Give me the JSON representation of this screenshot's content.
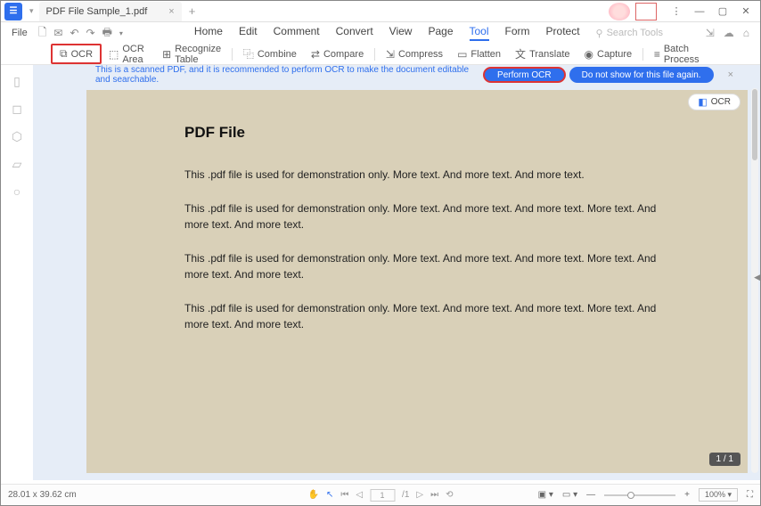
{
  "title_tab": "PDF File Sample_1.pdf",
  "menu_file": "File",
  "main_tabs": {
    "home": "Home",
    "edit": "Edit",
    "comment": "Comment",
    "convert": "Convert",
    "view": "View",
    "page": "Page",
    "tool": "Tool",
    "form": "Form",
    "protect": "Protect"
  },
  "search_placeholder": "Search Tools",
  "tools": {
    "ocr": "OCR",
    "ocr_area": "OCR Area",
    "recognize": "Recognize Table",
    "combine": "Combine",
    "compare": "Compare",
    "compress": "Compress",
    "flatten": "Flatten",
    "translate": "Translate",
    "capture": "Capture",
    "batch": "Batch Process"
  },
  "banner": {
    "msg": "This is a scanned PDF, and it is recommended to perform OCR to make the document editable and searchable.",
    "perform": "Perform OCR",
    "noshow": "Do not show for this file again."
  },
  "doc": {
    "heading": "PDF File",
    "p1": "This .pdf file is used for demonstration only. More text. And more text. And more text.",
    "p2": "This .pdf file is used for demonstration only. More text. And more text. And more text. More text. And more text. And more text.",
    "p3": "This .pdf file is used for demonstration only. More text. And more text. And more text. More text. And more text. And more text.",
    "p4": "This .pdf file is used for demonstration only. More text. And more text. And more text. More text. And more text. And more text."
  },
  "ocr_chip": "OCR",
  "page_counter": "1 / 1",
  "status": {
    "dim": "28.01 x 39.62 cm",
    "page_cur": "1",
    "page_total": "/1",
    "zoom": "100%"
  }
}
